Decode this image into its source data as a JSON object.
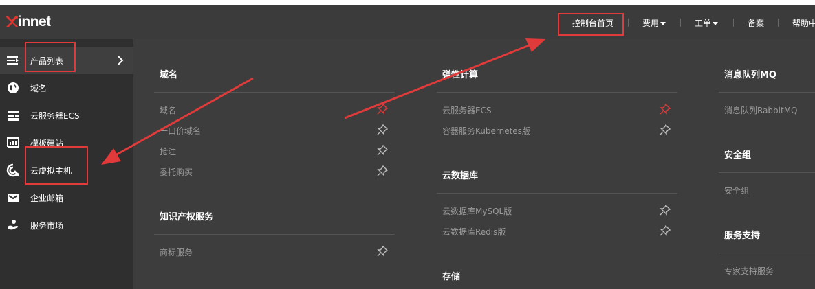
{
  "brand": {
    "logo_text": "innet"
  },
  "topnav": {
    "console_home": "控制台首页",
    "fees": "费用",
    "tickets": "工单",
    "filing": "备案",
    "help": "帮助中"
  },
  "sidebar": {
    "items": [
      {
        "label": "产品列表",
        "icon": "menu-icon"
      },
      {
        "label": "域名",
        "icon": "globe-icon"
      },
      {
        "label": "云服务器ECS",
        "icon": "server-icon"
      },
      {
        "label": "模板建站",
        "icon": "template-icon"
      },
      {
        "label": "云虚拟主机",
        "icon": "virtual-host-icon"
      },
      {
        "label": "企业邮箱",
        "icon": "mail-icon"
      },
      {
        "label": "服务市场",
        "icon": "market-icon"
      }
    ]
  },
  "catalog": {
    "domain": {
      "title": "域名",
      "links": [
        "域名",
        "一口价域名",
        "抢注",
        "委托购买"
      ]
    },
    "ip": {
      "title": "知识产权服务",
      "links": [
        "商标服务"
      ]
    },
    "compute": {
      "title": "弹性计算",
      "links": [
        "云服务器ECS",
        "容器服务Kubernetes版"
      ]
    },
    "database": {
      "title": "云数据库",
      "links": [
        "云数据库MySQL版",
        "云数据库Redis版"
      ]
    },
    "storage": {
      "title": "存储"
    },
    "mq": {
      "title": "消息队列MQ",
      "links": [
        "消息队列RabbitMQ"
      ]
    },
    "secgroup": {
      "title": "安全组",
      "links": [
        "安全组"
      ]
    },
    "support": {
      "title": "服务支持",
      "links": [
        "专家支持服务"
      ]
    }
  },
  "colors": {
    "annotation_red": "#e03a3a",
    "pinned_red": "#e03a3a",
    "pin_gray": "#bdbdbd"
  }
}
